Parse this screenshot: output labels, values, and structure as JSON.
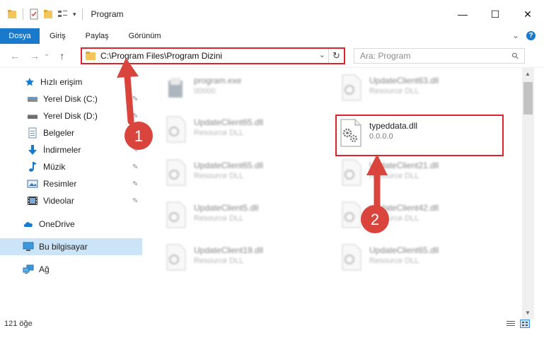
{
  "window": {
    "title": "Program",
    "minimize_glyph": "—",
    "maximize_glyph": "☐",
    "close_glyph": "✕"
  },
  "ribbon": {
    "tabs": [
      "Dosya",
      "Giriş",
      "Paylaş",
      "Görünüm"
    ],
    "expand_glyph": "⌄",
    "help_glyph": "?"
  },
  "address": {
    "path": "C:\\Program Files\\Program Dizini",
    "back_glyph": "←",
    "forward_glyph": "→",
    "recent_glyph": "⌄",
    "up_glyph": "↑",
    "dropdown_glyph": "⌄",
    "refresh_glyph": "↻"
  },
  "search": {
    "placeholder": "Ara: Program",
    "icon_glyph": "⚲"
  },
  "navpane": {
    "items": [
      {
        "label": "Hızlı erişim",
        "icon": "star-icon",
        "pinned": false
      },
      {
        "label": "Yerel Disk (C:)",
        "icon": "drive-icon",
        "pinned": true
      },
      {
        "label": "Yerel Disk (D:)",
        "icon": "drive-icon",
        "pinned": true
      },
      {
        "label": "Belgeler",
        "icon": "documents-icon",
        "pinned": true
      },
      {
        "label": "İndirmeler",
        "icon": "download-icon",
        "pinned": true
      },
      {
        "label": "Müzik",
        "icon": "music-icon",
        "pinned": true
      },
      {
        "label": "Resimler",
        "icon": "pictures-icon",
        "pinned": true
      },
      {
        "label": "Videolar",
        "icon": "videos-icon",
        "pinned": true
      },
      {
        "label": "OneDrive",
        "icon": "cloud-icon",
        "pinned": false
      },
      {
        "label": "Bu bilgisayar",
        "icon": "computer-icon",
        "pinned": false,
        "selected": true
      },
      {
        "label": "Ağ",
        "icon": "network-icon",
        "pinned": false
      }
    ],
    "pin_glyph": "✎"
  },
  "files": {
    "left_column": [
      {
        "name": "program.exe",
        "sub": "00000"
      },
      {
        "name": "UpdateClient65.dll",
        "sub": "Resource DLL"
      },
      {
        "name": "UpdateClient65.dll",
        "sub": "Resource DLL"
      },
      {
        "name": "UpdateClient5.dll",
        "sub": "Resource DLL"
      },
      {
        "name": "UpdateClient19.dll",
        "sub": "Resource DLL"
      }
    ],
    "right_column": [
      {
        "name": "UpdateClient63.dll",
        "sub": "Resource DLL"
      },
      {
        "name": "typeddata.dll",
        "sub": "0.0.0.0",
        "highlighted": true
      },
      {
        "name": "UpdateClient21.dll",
        "sub": "Resource DLL"
      },
      {
        "name": "UpdateClient42.dll",
        "sub": "Resource DLL"
      },
      {
        "name": "UpdateClient65.dll",
        "sub": "Resource DLL"
      }
    ]
  },
  "annotations": [
    {
      "number": "1"
    },
    {
      "number": "2"
    }
  ],
  "status": {
    "count": "121 öğe"
  },
  "scrollbar": {
    "up_glyph": "▲",
    "down_glyph": "▼"
  },
  "colors": {
    "accent": "#1979ca",
    "highlight_red": "#e0222a",
    "annotation_red": "#d9453d",
    "selection": "#cce4f7"
  }
}
